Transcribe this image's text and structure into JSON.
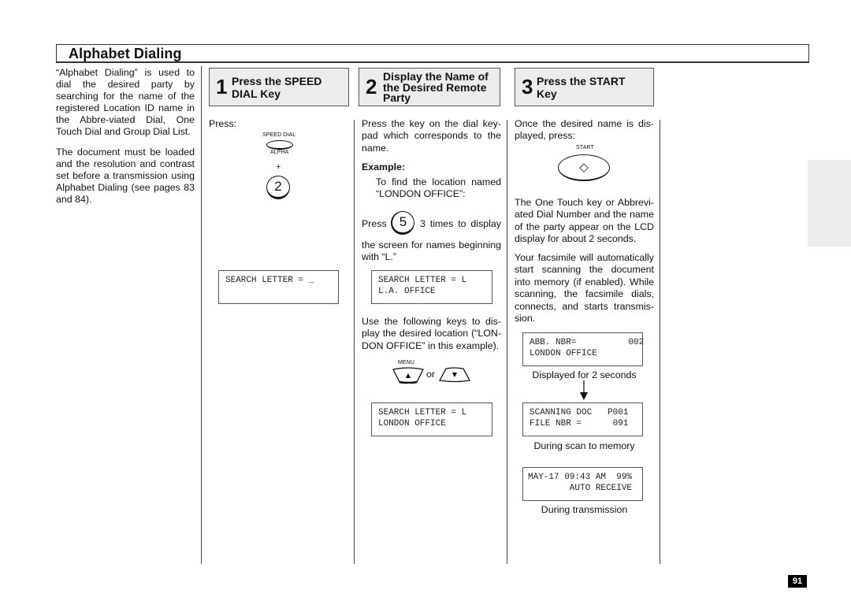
{
  "header": {
    "title": "Alphabet Dialing"
  },
  "intro": {
    "paragraphs": [
      "“Alphabet Dialing” is used to dial the desired party by searching for the name of the registered Location ID name in the Abbre-viated Dial, One Touch Dial and Group Dial List.",
      "The document must be loaded and the resolution and contrast set before a transmission using Alphabet Dialing (see pages 83 and 84)."
    ]
  },
  "steps": [
    {
      "number": "1",
      "heading_lines": [
        "Press the SPEED",
        "DIAL Key"
      ],
      "press_label": "Press:",
      "key_top_label": "SPEED DIAL",
      "key_bottom_label": "ALPHA",
      "plus": "+",
      "key_digit": "2",
      "lcd": [
        "SEARCH LETTER = _",
        ""
      ]
    },
    {
      "number": "2",
      "heading_lines": [
        "Display the Name of",
        "the Desired Remote",
        "Party"
      ],
      "body": "Press the key on the dial key-pad which corresponds to the name.",
      "example_label": "Example:",
      "example_text": "To find the location named “LONDON OFFICE”:",
      "press_word": "Press",
      "key_digit": "5",
      "press_rest": "3 times to display",
      "press_cont": "the screen for names beginning with “L.”",
      "lcd1": [
        "SEARCH LETTER = L",
        "L.A. OFFICE"
      ],
      "use_keys_text": "Use the following keys to dis-play the desired location (“LON-DON OFFICE” in this example).",
      "menu_label": "MENU",
      "or_label": "or",
      "up_arrow": "▲",
      "down_arrow": "▼",
      "lcd2": [
        "SEARCH LETTER = L",
        "LONDON OFFICE"
      ]
    },
    {
      "number": "3",
      "heading_lines": [
        "Press the START",
        "Key"
      ],
      "body1": "Once the desired name is dis-played, press:",
      "start_label": "START",
      "start_symbol": "◇",
      "body2": "The One Touch key or Abbrevi-ated Dial Number and the name of the party appear on the LCD display for about 2 seconds.",
      "body3": "Your facsimile will automatically start scanning the document into memory (if enabled). While scanning, the facsimile dials, connects, and starts transmis-sion.",
      "lcd1": [
        "ABB. NBR=          002",
        "LONDON OFFICE"
      ],
      "caption1": "Displayed for 2 seconds",
      "lcd2": [
        "SCANNING DOC   P001",
        "FILE NBR =      091"
      ],
      "caption2": "During scan to memory",
      "lcd3": [
        "MAY-17 09:43 AM  99%",
        "        AUTO RECEIVE"
      ],
      "caption3": "During transmission"
    }
  ],
  "footer": {
    "page_number": "91"
  }
}
